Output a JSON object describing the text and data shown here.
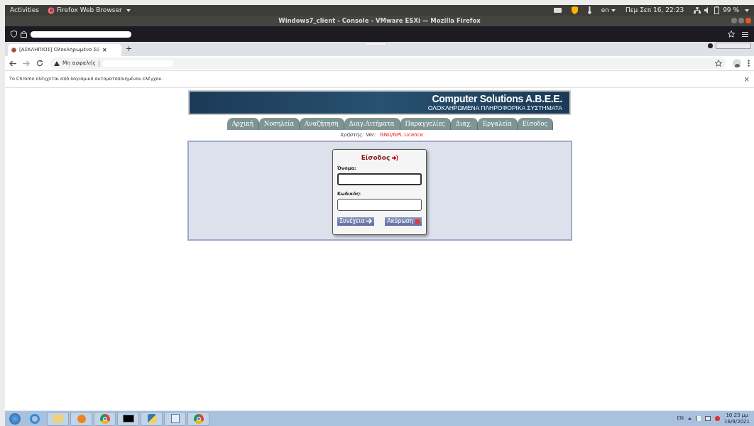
{
  "top_bar": {
    "activities": "Activities",
    "app_menu": "Firefox Web Browser",
    "language": "en",
    "clock": "Πεμ Σεπ 16, 22:23",
    "battery": "99 %"
  },
  "window": {
    "title": "Windows7_client - Console - VMware ESXi — Mozilla Firefox"
  },
  "browser_tab": {
    "title": "[ΑΣΚΛΗΠΙΟΣ] Ολοκληρωμένο Σύ",
    "close": "×",
    "new_tab": "+"
  },
  "address_bar": {
    "security": "Μη ασφαλής"
  },
  "info_bar": {
    "text": "Το Chrome ελέγχεται από λογισμικό αυτοματοποιημένου ελέγχου.",
    "close": "×"
  },
  "banner": {
    "title": "Computer Solutions A.B.E.E.",
    "subtitle": "ΟΛΟΚΛΗΡΩΜΕΝΑ ΠΛΗΡΟΦΟΡΙΚΑ ΣΥΣΤΗΜΑΤΑ"
  },
  "menu": [
    {
      "label": "Αρχική",
      "selected": false
    },
    {
      "label": "Νοσηλεία",
      "selected": false
    },
    {
      "label": "Αναζήτηση",
      "selected": false
    },
    {
      "label": "Διαγ.Αιτήματα",
      "selected": false
    },
    {
      "label": "Παραγγελίες",
      "selected": false
    },
    {
      "label": "Διαχ.",
      "selected": false
    },
    {
      "label": "Εργαλεία",
      "selected": false
    },
    {
      "label": "Είσοδος",
      "selected": false
    }
  ],
  "user_line": {
    "user_label": "Χρήστης:",
    "version_label": "Ver:",
    "license": "GNU/GPL Licence"
  },
  "login": {
    "title": "Είσοδος",
    "username_label": "Όνομα:",
    "password_label": "Κωδικός:",
    "continue": "Συνέχεια",
    "cancel": "Ακύρωση"
  },
  "taskbar": {
    "language": "EN",
    "time": "10:23 μμ",
    "date": "16/9/2021"
  }
}
